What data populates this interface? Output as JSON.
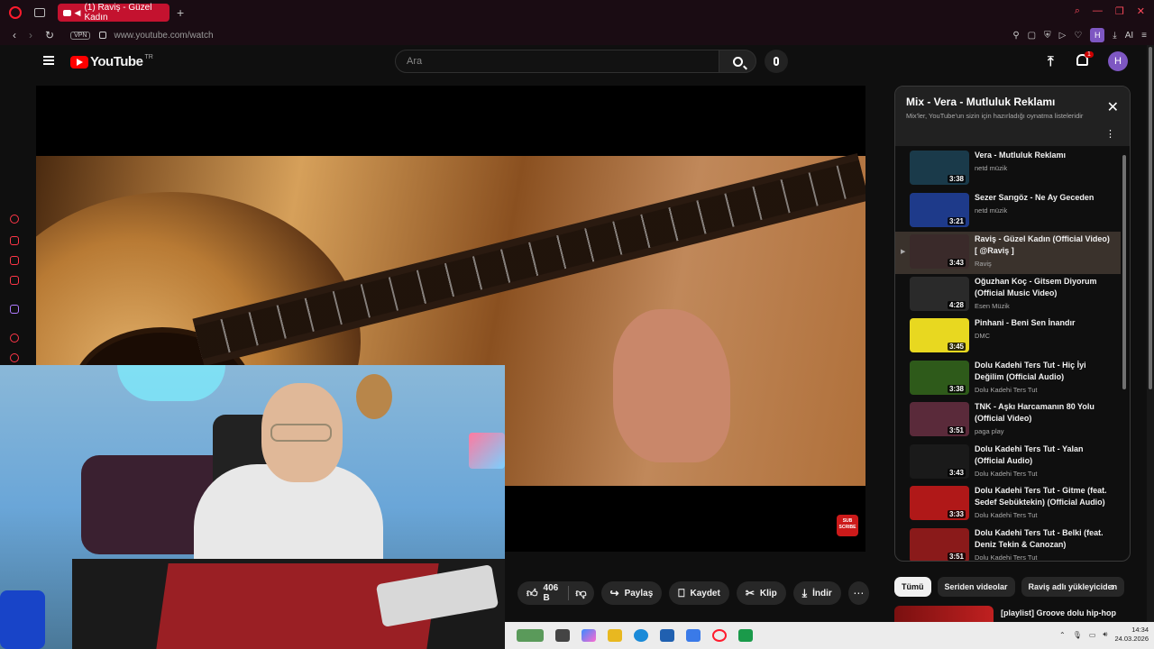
{
  "browser": {
    "tab_title": "(1) Raviş - Güzel Kadın",
    "url": "www.youtube.com/watch",
    "vpn_label": "VPN",
    "profile_initial": "H",
    "ai_label": "AI"
  },
  "header": {
    "logo_text": "YouTube",
    "country_code": "TR",
    "search_placeholder": "Ara",
    "notification_count": "1",
    "avatar_initial": "H"
  },
  "player": {
    "subscribe_badge": "SUB SCRIBE"
  },
  "actions": {
    "like_count": "406 B",
    "share_label": "Paylaş",
    "save_label": "Kaydet",
    "clip_label": "Klip",
    "download_label": "İndir"
  },
  "playlist": {
    "title": "Mix - Vera - Mutluluk Reklamı",
    "subtitle": "Mix'ler, YouTube'un sizin için hazırladığı oynatma listeleridir",
    "items": [
      {
        "title": "Vera - Mutluluk Reklamı",
        "channel": "netd müzik",
        "duration": "3:38",
        "thumb_color": "#1a3a4a",
        "active": false
      },
      {
        "title": "Sezer Sarıgöz - Ne Ay Geceden",
        "channel": "netd müzik",
        "duration": "3:21",
        "thumb_color": "#1e3a8a",
        "active": false
      },
      {
        "title": "Raviş - Güzel Kadın (Official Video) [ @Raviş ]",
        "channel": "Raviş",
        "duration": "3:43",
        "thumb_color": "#3a2a2a",
        "active": true
      },
      {
        "title": "Oğuzhan Koç - Gitsem Diyorum (Official Music Video)",
        "channel": "Esen Müzik",
        "duration": "4:28",
        "thumb_color": "#2a2a2a",
        "active": false
      },
      {
        "title": "Pinhani - Beni Sen İnandır",
        "channel": "DMC",
        "duration": "3:45",
        "thumb_color": "#e8d820",
        "active": false
      },
      {
        "title": "Dolu Kadehi Ters Tut - Hiç İyi Değilim (Official Audio)",
        "channel": "Dolu Kadehi Ters Tut",
        "duration": "3:38",
        "thumb_color": "#2e5a1a",
        "active": false
      },
      {
        "title": "TNK - Aşkı Harcamanın 80 Yolu (Official Video)",
        "channel": "paga play",
        "duration": "3:51",
        "thumb_color": "#5a2a3a",
        "active": false
      },
      {
        "title": "Dolu Kadehi Ters Tut - Yalan (Official Audio)",
        "channel": "Dolu Kadehi Ters Tut",
        "duration": "3:43",
        "thumb_color": "#1a1a1a",
        "active": false
      },
      {
        "title": "Dolu Kadehi Ters Tut - Gitme (feat. Sedef Sebüktekin) (Official Audio)",
        "channel": "Dolu Kadehi Ters Tut",
        "duration": "3:33",
        "thumb_color": "#b01818",
        "active": false
      },
      {
        "title": "Dolu Kadehi Ters Tut - Belki (feat. Deniz Tekin & Canozan)",
        "channel": "Dolu Kadehi Ters Tut",
        "duration": "3:51",
        "thumb_color": "#8a1a1a",
        "active": false
      }
    ]
  },
  "chips": [
    "Tümü",
    "Seriden videolar",
    "Raviş adlı yükleyiciden"
  ],
  "recommendation": {
    "title": "[playlist] Groove dolu hip-hop"
  },
  "taskbar": {
    "time": "14:34",
    "date": "24.03.2026"
  },
  "colors": {
    "youtube_red": "#ff0000",
    "opera_red": "#ff1b2d",
    "tab_red": "#c4122f",
    "avatar_purple": "#7e57c2"
  }
}
